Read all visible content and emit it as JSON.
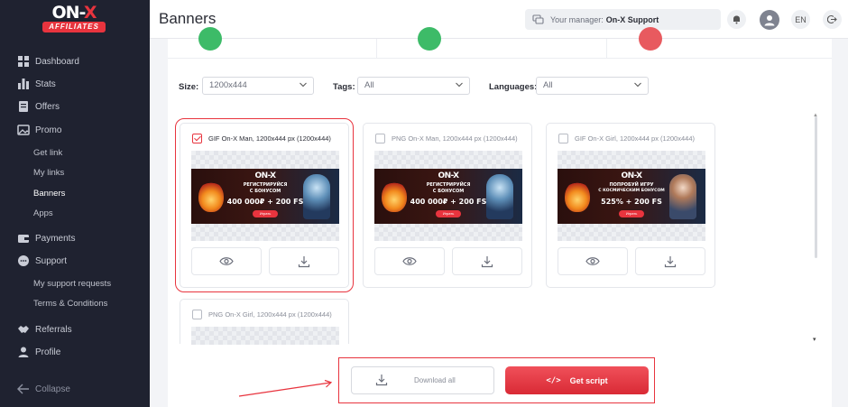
{
  "brand": {
    "name_main": "ON-",
    "name_x": "X",
    "sub": "AFFILIATES",
    "accent": "#e8343e"
  },
  "sidebar": {
    "items": [
      {
        "label": "Dashboard",
        "icon": "dashboard-icon"
      },
      {
        "label": "Stats",
        "icon": "bar-chart-icon"
      },
      {
        "label": "Offers",
        "icon": "offers-icon"
      },
      {
        "label": "Promo",
        "icon": "image-icon"
      },
      {
        "label": "Payments",
        "icon": "wallet-icon"
      },
      {
        "label": "Support",
        "icon": "chat-icon"
      },
      {
        "label": "Referrals",
        "icon": "handshake-icon"
      },
      {
        "label": "Profile",
        "icon": "user-icon"
      }
    ],
    "promo_sub": [
      "Get link",
      "My links",
      "Banners",
      "Apps"
    ],
    "support_sub": [
      "My support requests",
      "Terms & Conditions"
    ],
    "active_sub": "Banners",
    "collapse_label": "Collapse"
  },
  "header": {
    "title": "Banners",
    "manager_prefix": "Your manager:",
    "manager_name": "On-X Support",
    "language": "EN"
  },
  "filters": {
    "size_label": "Size:",
    "size_value": "1200x444",
    "tags_label": "Tags:",
    "tags_value": "All",
    "languages_label": "Languages:",
    "languages_value": "All"
  },
  "banners": [
    {
      "title": "GIF On-X Man, 1200x444 px (1200x444)",
      "checked": true,
      "lines": [
        "ON-X",
        "РЕГИСТРИРУЙСЯ",
        "С БОНУСОМ",
        "400 000₽ + 200 FS",
        "Играть"
      ]
    },
    {
      "title": "PNG On-X Man, 1200x444 px (1200x444)",
      "checked": false,
      "lines": [
        "ON-X",
        "РЕГИСТРИРУЙСЯ",
        "С БОНУСОМ",
        "400 000₽ + 200 FS",
        "Играть"
      ]
    },
    {
      "title": "GIF On-X Girl, 1200x444 px (1200x444)",
      "checked": false,
      "lines": [
        "ON-X",
        "ПОПРОБУЙ ИГРУ",
        "С КОСМИЧЕСКИМ БОНУСОМ",
        "525% + 200 FS",
        "Играть"
      ]
    },
    {
      "title": "PNG On-X Girl, 1200x444 px (1200x444)",
      "checked": false
    }
  ],
  "bottom": {
    "download_all": "Download all",
    "get_script": "Get script",
    "get_script_icon": "</>"
  }
}
